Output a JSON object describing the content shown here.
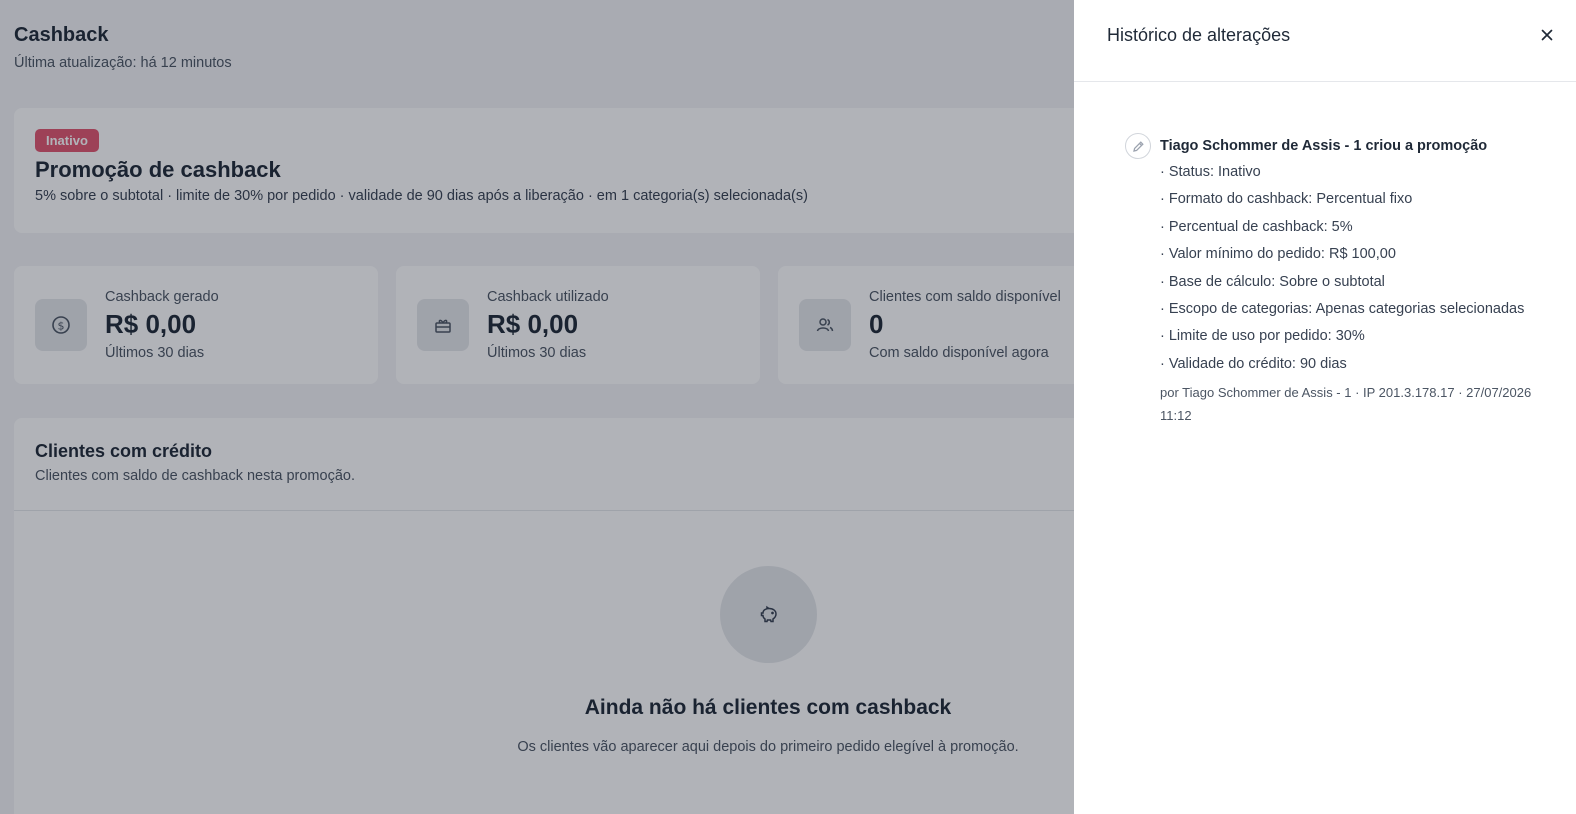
{
  "page": {
    "title": "Cashback",
    "last_update": "Última atualização: há 12 minutos"
  },
  "promotion": {
    "status_badge": "Inativo",
    "title": "Promoção de cashback",
    "description": "5% sobre o subtotal · limite de 30% por pedido · validade de 90 dias após a liberação · em 1 categoria(s) selecionada(s)"
  },
  "stats": [
    {
      "icon": "dollar-icon",
      "label": "Cashback gerado",
      "value": "R$ 0,00",
      "foot": "Últimos 30 dias"
    },
    {
      "icon": "gift-icon",
      "label": "Cashback utilizado",
      "value": "R$ 0,00",
      "foot": "Últimos 30 dias"
    },
    {
      "icon": "users-icon",
      "label": "Clientes com saldo disponível",
      "value": "0",
      "foot": "Com saldo disponível agora"
    }
  ],
  "clients": {
    "title": "Clientes com crédito",
    "subtitle": "Clientes com saldo de cashback nesta promoção.",
    "empty_icon": "piggy-bank-icon",
    "empty_title": "Ainda não há clientes com cashback",
    "empty_text": "Os clientes vão aparecer aqui depois do primeiro pedido elegível à promoção."
  },
  "drawer": {
    "title": "Histórico de alterações",
    "close_icon": "close-icon",
    "entry": {
      "icon": "pencil-icon",
      "title": "Tiago Schommer de Assis - 1 criou a promoção",
      "changes": [
        "· Status: Inativo",
        "· Formato do cashback: Percentual fixo",
        "· Percentual de cashback: 5%",
        "· Valor mínimo do pedido: R$ 100,00",
        "· Base de cálculo: Sobre o subtotal",
        "· Escopo de categorias: Apenas categorias selecionadas",
        "· Limite de uso por pedido: 30%",
        "· Validade do crédito: 90 dias"
      ],
      "meta": "por Tiago Schommer de Assis - 1 · IP 201.3.178.17 · 27/07/2026 11:12"
    }
  },
  "colors": {
    "badge_inactive": "#e2566f",
    "overlay": "#111827"
  }
}
